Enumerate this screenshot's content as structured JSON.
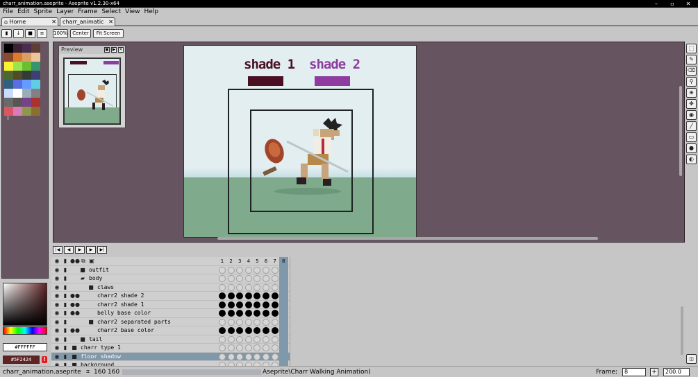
{
  "window": {
    "title": "charr_animation.aseprite - Aseprite v1.2.30-x64",
    "minimize": "–",
    "maximize": "▫",
    "close": "✕"
  },
  "menu": [
    "File",
    "Edit",
    "Sprite",
    "Layer",
    "Frame",
    "Select",
    "View",
    "Help"
  ],
  "tabs": [
    {
      "label": "Home",
      "close": "✕"
    },
    {
      "label": "charr_animatic",
      "close": "✕"
    }
  ],
  "toolbar": {
    "zoom": "100%",
    "center": "Center",
    "fit": "Fit Screen"
  },
  "palette": [
    "#000000",
    "#3c2233",
    "#4a2e4f",
    "#5f3c36",
    "#8a4a2f",
    "#dd7b2b",
    "#d9a066",
    "#eec39a",
    "#fbf236",
    "#99e550",
    "#6abe30",
    "#37946e",
    "#4b692f",
    "#524b24",
    "#323c39",
    "#3f3f74",
    "#306082",
    "#5b6ee1",
    "#639bff",
    "#5fcde4",
    "#cbdbfc",
    "#ffffff",
    "#9badb7",
    "#847e87",
    "#696a6a",
    "#595652",
    "#76428a",
    "#ac3232",
    "#d95763",
    "#d77bba",
    "#8f974a",
    "#8a6f30"
  ],
  "colors": {
    "foreground": "#FFFFFF",
    "background": "#5F2424"
  },
  "preview": {
    "title": "Preview",
    "btn1": "▣",
    "btn2": "▶",
    "btn3": "✕"
  },
  "canvas": {
    "shade1_label": "shade 1",
    "shade1_color": "#4b0f24",
    "shade2_label": "shade 2",
    "shade2_color": "#8e3ca0"
  },
  "tools": [
    "marquee-icon",
    "pencil-icon",
    "eraser-icon",
    "eyedropper-icon",
    "zoom-icon",
    "move-icon",
    "bucket-icon",
    "line-icon",
    "rectangle-icon",
    "blur-icon",
    "smudge-icon"
  ],
  "timeline": {
    "frames": [
      "1",
      "2",
      "3",
      "4",
      "5",
      "6",
      "7",
      "8"
    ],
    "current_frame": "8",
    "layers": [
      {
        "name": "outfit",
        "indent": 1,
        "type": "group",
        "cels": [
          "e",
          "e",
          "e",
          "e",
          "e",
          "e",
          "e",
          "e"
        ]
      },
      {
        "name": "body",
        "indent": 1,
        "type": "group-open",
        "cels": [
          "e",
          "e",
          "e",
          "e",
          "e",
          "e",
          "e",
          "e"
        ]
      },
      {
        "name": "claws",
        "indent": 2,
        "type": "group",
        "cels": [
          "e",
          "e",
          "e",
          "e",
          "e",
          "e",
          "e",
          "e"
        ]
      },
      {
        "name": "charr2 shade 2",
        "indent": 2,
        "type": "layer",
        "cels": [
          "f",
          "f",
          "f",
          "f",
          "f",
          "f",
          "f",
          "r"
        ]
      },
      {
        "name": "charr2 shade 1",
        "indent": 2,
        "type": "layer",
        "cels": [
          "f",
          "f",
          "f",
          "f",
          "f",
          "f",
          "f",
          "r"
        ]
      },
      {
        "name": "belly base color",
        "indent": 2,
        "type": "layer",
        "cels": [
          "f",
          "f",
          "f",
          "f",
          "f",
          "f",
          "f",
          "r"
        ]
      },
      {
        "name": "charr2 separated parts",
        "indent": 2,
        "type": "group",
        "cels": [
          "e",
          "e",
          "e",
          "e",
          "e",
          "e",
          "e",
          "e"
        ]
      },
      {
        "name": "charr2 base color",
        "indent": 2,
        "type": "layer",
        "cels": [
          "f",
          "f",
          "f",
          "f",
          "f",
          "f",
          "f",
          "r"
        ]
      },
      {
        "name": "tail",
        "indent": 1,
        "type": "group",
        "cels": [
          "e",
          "e",
          "e",
          "e",
          "e",
          "e",
          "e",
          "e"
        ]
      },
      {
        "name": "charr type 1",
        "indent": 0,
        "type": "group",
        "cels": [
          "e",
          "e",
          "e",
          "e",
          "e",
          "e",
          "e",
          "e"
        ]
      },
      {
        "name": "floor shadow",
        "indent": 0,
        "type": "group",
        "cels": [
          "e",
          "e",
          "e",
          "e",
          "e",
          "e",
          "e",
          "e"
        ],
        "selected": true
      },
      {
        "name": "background",
        "indent": 0,
        "type": "group",
        "cels": [
          "e",
          "e",
          "e",
          "e",
          "e",
          "e",
          "e",
          "e"
        ]
      }
    ]
  },
  "status": {
    "filename": "charr_animation.aseprite",
    "dimensions": "160 160",
    "path_tail": "Aseprite\\Charr Walking Animation)",
    "frame_label": "Frame:",
    "frame_value": "8",
    "zoom_value": "200.0"
  }
}
